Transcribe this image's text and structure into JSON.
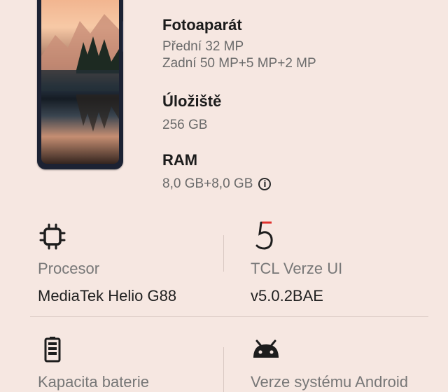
{
  "specs": {
    "camera": {
      "title": "Fotoaparát",
      "front": "Přední  32 MP",
      "rear": "Zadní  50 MP+5 MP+2 MP"
    },
    "storage": {
      "title": "Úložiště",
      "value": "256 GB"
    },
    "ram": {
      "title": "RAM",
      "value": "8,0 GB+8,0 GB",
      "info_icon": "info-icon"
    }
  },
  "grid": {
    "processor": {
      "icon": "cpu-chip-icon",
      "label": "Procesor",
      "value": "MediaTek Helio G88"
    },
    "tcl_ui": {
      "icon": "tcl-ui-5-logo",
      "logo_text": "5",
      "label": "TCL Verze UI",
      "value": "v5.0.2BAE"
    },
    "battery": {
      "icon": "battery-icon",
      "label": "Kapacita baterie"
    },
    "android": {
      "icon": "android-icon",
      "label": "Verze systému Android"
    }
  },
  "colors": {
    "background": "#f6e7e1",
    "tcl_red": "#e0312d"
  }
}
